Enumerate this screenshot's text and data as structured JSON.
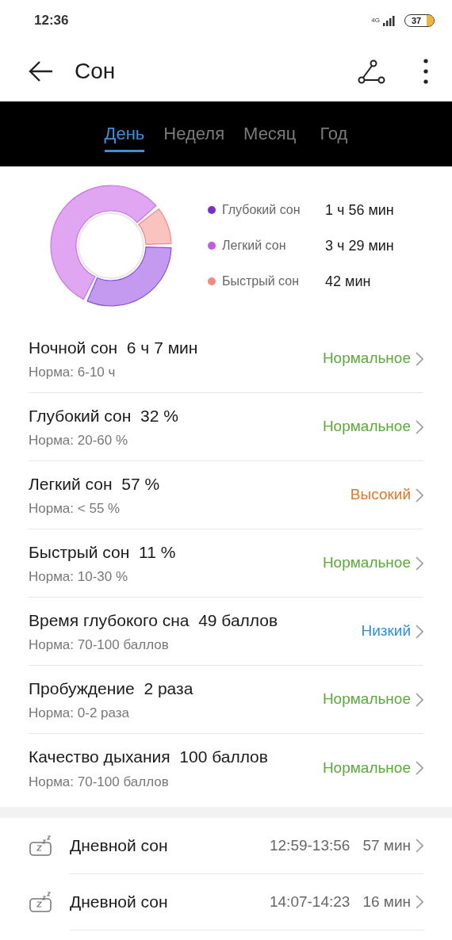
{
  "status_bar": {
    "time": "12:36",
    "network": "4G",
    "battery": "37"
  },
  "header": {
    "title": "Сон"
  },
  "tabs": [
    {
      "label": "День",
      "selected": true
    },
    {
      "label": "Неделя",
      "selected": false
    },
    {
      "label": "Месяц",
      "selected": false
    },
    {
      "label": "Год",
      "selected": false
    }
  ],
  "summary": {
    "chart_data": {
      "type": "donut",
      "values": [
        32,
        57,
        11
      ]
    },
    "legend": [
      {
        "name": "Глубокий сон",
        "value": "1 ч 56 мин",
        "color": "#7b2fc9"
      },
      {
        "name": "Легкий сон",
        "value": "3 ч 29 мин",
        "color": "#c15de0"
      },
      {
        "name": "Быстрый сон",
        "value": "42 мин",
        "color": "#f08a85"
      }
    ]
  },
  "metrics": [
    {
      "title": "Ночной сон  6 ч 7 мин",
      "norm": "Норма: 6-10 ч",
      "status": "Нормальное",
      "color": "#5aaa3a"
    },
    {
      "title": "Глубокий сон  32 %",
      "norm": "Норма: 20-60 %",
      "status": "Нормальное",
      "color": "#5aaa3a"
    },
    {
      "title": "Легкий сон  57 %",
      "norm": "Норма: < 55 %",
      "status": "Высокий",
      "color": "#e0782c"
    },
    {
      "title": "Быстрый сон  11 %",
      "norm": "Норма: 10-30 %",
      "status": "Нормальное",
      "color": "#5aaa3a"
    },
    {
      "title": "Время глубокого сна  49 баллов",
      "norm": "Норма: 70-100 баллов",
      "status": "Низкий",
      "color": "#2f90cf"
    },
    {
      "title": "Пробуждение  2 раза",
      "norm": "Норма: 0-2 раза",
      "status": "Нормальное",
      "color": "#5aaa3a"
    },
    {
      "title": "Качество дыхания  100 баллов",
      "norm": "Норма: 70-100 баллов",
      "status": "Нормальное",
      "color": "#5aaa3a"
    }
  ],
  "naps": [
    {
      "title": "Дневной сон",
      "time": "12:59-13:56",
      "duration": "57 мин"
    },
    {
      "title": "Дневной сон",
      "time": "14:07-14:23",
      "duration": "16 мин"
    }
  ]
}
